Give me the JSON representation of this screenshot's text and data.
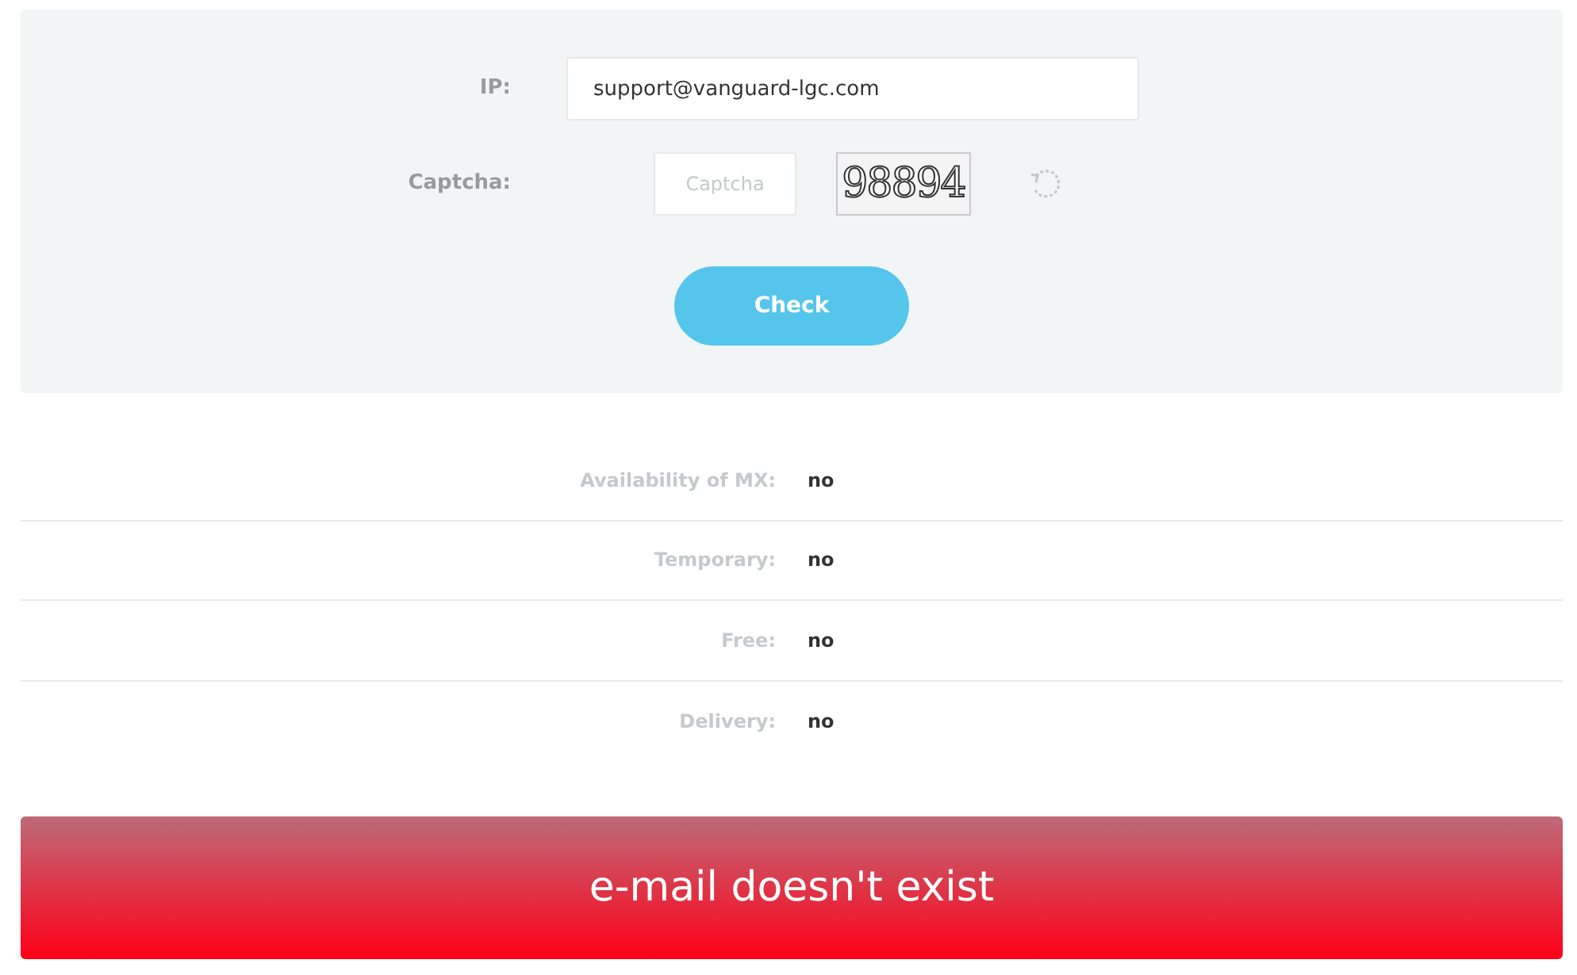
{
  "form": {
    "ip_label": "IP:",
    "ip_value": "support@vanguard-lgc.com",
    "captcha_label": "Captcha:",
    "captcha_placeholder": "Captcha",
    "captcha_code": "98894",
    "submit": "Check"
  },
  "results": [
    {
      "label": "Availability of MX:",
      "value": "no"
    },
    {
      "label": "Temporary:",
      "value": "no"
    },
    {
      "label": "Free:",
      "value": "no"
    },
    {
      "label": "Delivery:",
      "value": "no"
    }
  ],
  "verdict": {
    "text": "e-mail doesn't exist"
  }
}
